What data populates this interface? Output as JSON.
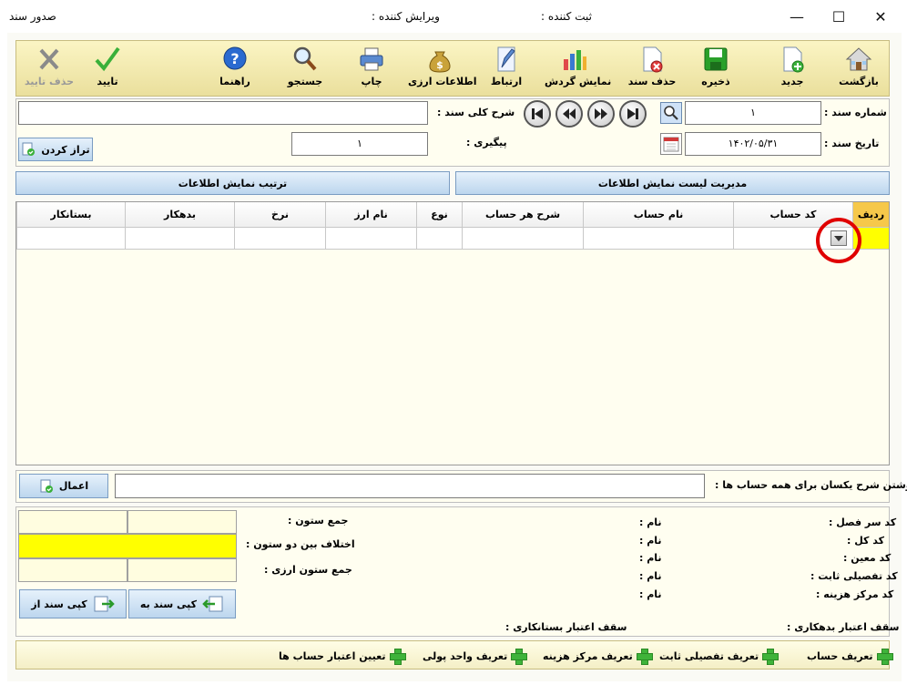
{
  "window": {
    "title": "صدور سند",
    "registrar_label": "ثبت کننده :",
    "editor_label": "ویرایش کننده :",
    "minimize": "—",
    "maximize": "☐",
    "close": "✕"
  },
  "toolbar": {
    "back": "بازگشت",
    "new": "جدید",
    "save": "ذخیره",
    "delete_doc": "حذف سند",
    "show_turnover": "نمایش گردش",
    "link": "ارتباط",
    "currency_info": "اطلاعات ارزی",
    "print": "چاپ",
    "search": "جستجو",
    "help": "راهنما",
    "confirm": "تایید",
    "delete_confirm": "حذف تایید"
  },
  "header": {
    "doc_number_label": "شماره سند :",
    "doc_number": "۱",
    "doc_date_label": "تاریخ سند :",
    "doc_date": "۱۴۰۲/۰۵/۳۱",
    "general_desc_label": "شرح کلی سند :",
    "general_desc": "",
    "followup_label": "پیگیری :",
    "followup": "۱",
    "balance_button": "تراز کردن"
  },
  "tabs": {
    "manage_list": "مدیریت لیست نمایش اطلاعات",
    "arrange_display": "ترتیب نمایش اطلاعات"
  },
  "grid": {
    "columns": [
      "ردیف",
      "کد حساب",
      "نام حساب",
      "شرح هر حساب",
      "نوع",
      "نام ارز",
      "نرخ",
      "بدهکار",
      "بستانکار"
    ]
  },
  "bulk_desc": {
    "label": "نوشتن شرح یکسان برای همه حساب ها :",
    "value": "",
    "apply_button": "اعمال"
  },
  "summary": {
    "column_sum_label": "جمع ستون :",
    "difference_label": "اختلاف بین دو ستون :",
    "currency_sum_label": "جمع ستون ارزی :",
    "copy_to": "کپی سند به",
    "copy_from": "کپی سند از"
  },
  "account_info": {
    "rows": [
      {
        "label": "کد سر فصل :",
        "name": "نام :"
      },
      {
        "label": "کد کل :",
        "name": "نام :"
      },
      {
        "label": "کد معین :",
        "name": "نام :"
      },
      {
        "label": "کد تفصیلی ثابت :",
        "name": "نام :"
      },
      {
        "label": "کد مرکز هزینه :",
        "name": "نام :"
      }
    ],
    "debit_limit": "سقف اعتبار بدهکاری :",
    "credit_limit": "سقف اعتبار بستانکاری :"
  },
  "footer": {
    "define_account": "تعریف حساب",
    "define_fixed_detail": "تعریف تفصیلی ثابت",
    "define_cost_center": "تعریف مرکز هزینه",
    "define_currency": "تعریف واحد پولی",
    "set_account_credit": "تعیین اعتبار حساب ها"
  },
  "colors": {
    "toolbar_bg": "#f3eab0",
    "panel_bg": "#fffef0",
    "highlight": "#ffff00",
    "annotation": "#e00000"
  }
}
